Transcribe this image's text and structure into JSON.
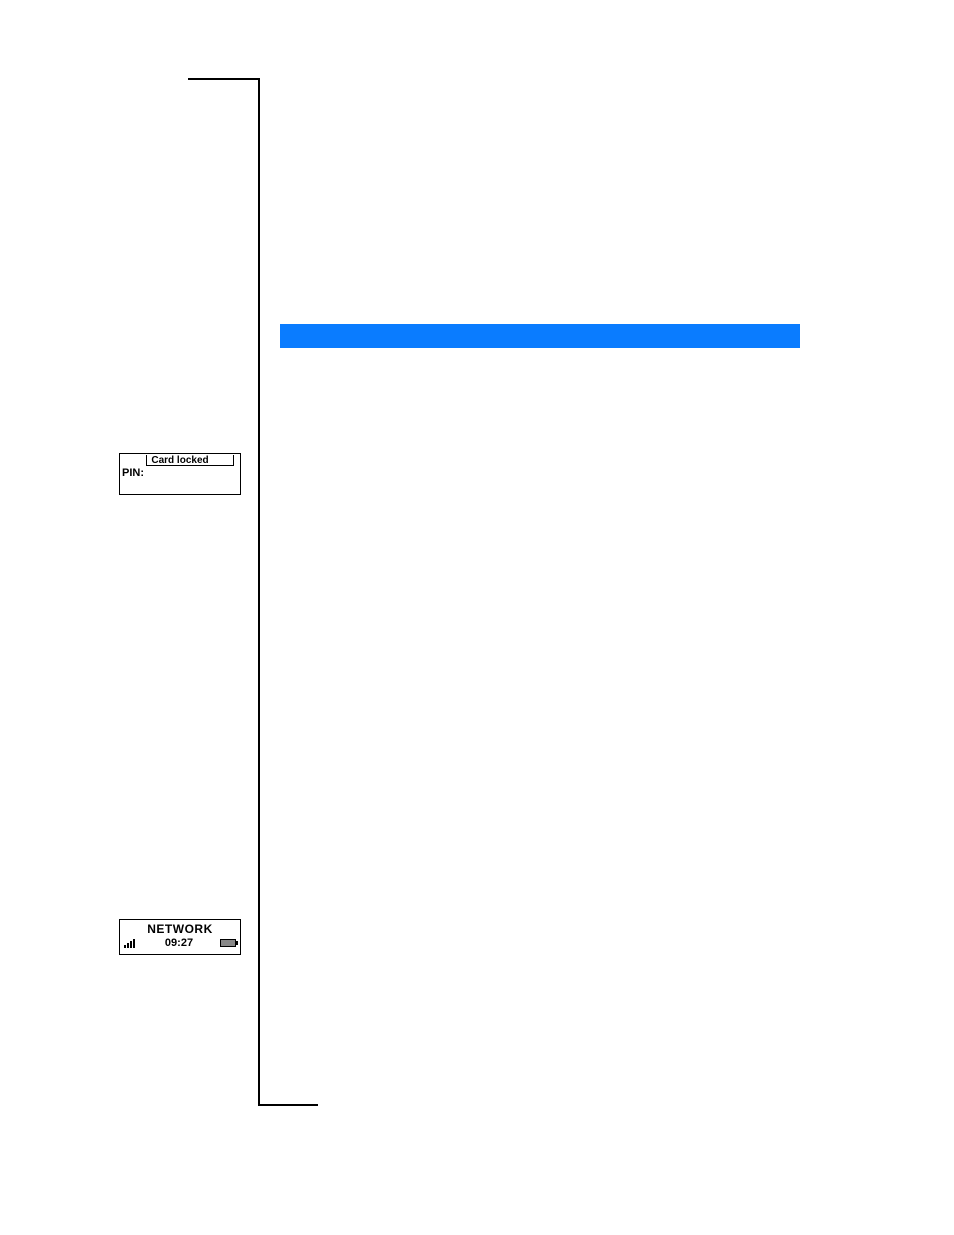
{
  "highlight_bar": {
    "color": "#0a7cff"
  },
  "screens": {
    "card_locked": {
      "title": "Card locked",
      "field_label": "PIN:"
    },
    "network": {
      "name": "NETWORK",
      "time": "09:27"
    }
  }
}
